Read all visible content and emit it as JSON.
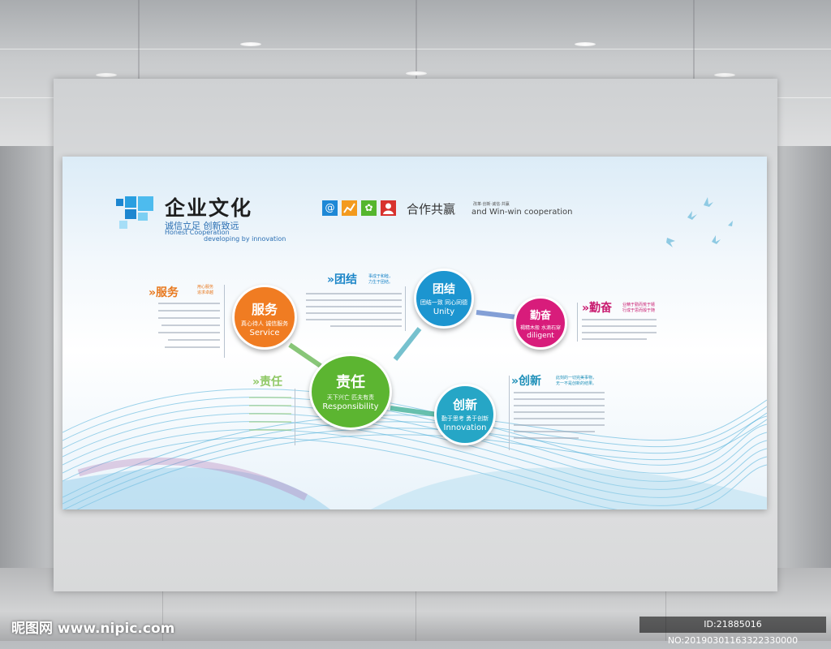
{
  "title": {
    "main": "企业文化",
    "sub": "诚信立足 创新致远",
    "en1": "Honest Cooperation",
    "en2": "developing by innovation"
  },
  "icons": [
    "at-icon",
    "chart-icon",
    "flower-icon",
    "person-icon"
  ],
  "icon_colors": [
    "#1e88d6",
    "#f39a1e",
    "#55b62e",
    "#d8322e"
  ],
  "slogan": {
    "main": "合作共赢",
    "small1": "改革·创新·诚信·共赢",
    "en": "and Win-win cooperation"
  },
  "circles": {
    "service": {
      "title": "服务",
      "sub": "真心待人 诚信服务",
      "en": "Service",
      "color": "#f07c22"
    },
    "unity": {
      "title": "团结",
      "sub": "团结一致 同心同德",
      "en": "Unity",
      "color": "#1c95d0"
    },
    "diligent": {
      "title": "勤奋",
      "sub": "褐精木般 水滴石穿",
      "en": "diligent",
      "color": "#d81c7b"
    },
    "responsibility": {
      "title": "责任",
      "sub": "天下兴亡 匹夫有责",
      "en": "Responsibility",
      "color": "#5cb531"
    },
    "innovation": {
      "title": "创新",
      "sub": "勤于思考 勇于创新",
      "en": "Innovation",
      "color": "#26a6c6"
    }
  },
  "sections": {
    "service": {
      "head": "服务",
      "tag1": "用心服务",
      "tag2": "追求卓越"
    },
    "unity": {
      "head": "团结",
      "tag1": "事成于和睦，",
      "tag2": "力生于团结。"
    },
    "diligent": {
      "head": "勤奋",
      "tag1": "业精于勤而荒于嬉",
      "tag2": "行成于思而毁于随"
    },
    "responsibility": {
      "head": "责任"
    },
    "innovation": {
      "head": "创新",
      "tag1": "此刻的一切完美事物，",
      "tag2": "无一不是创新的结果。"
    }
  },
  "watermark": "昵图网 www.nipic.com",
  "id_tag": "ID:21885016 NO:20190301163322330000"
}
